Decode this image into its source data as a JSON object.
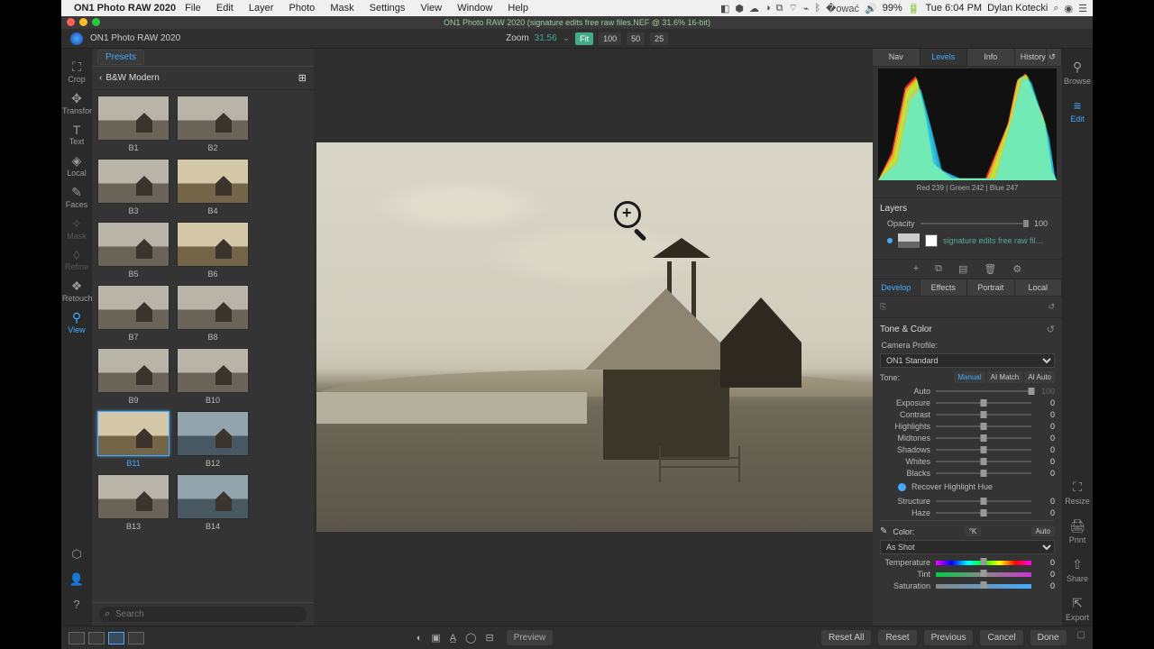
{
  "menubar": {
    "app": "ON1 Photo RAW 2020",
    "items": [
      "File",
      "Edit",
      "Layer",
      "Photo",
      "Mask",
      "Settings",
      "View",
      "Window",
      "Help"
    ],
    "battery": "99%",
    "clock": "Tue 6:04 PM",
    "user": "Dylan Kotecki"
  },
  "window": {
    "title": "ON1 Photo RAW 2020 (signature edits free raw files.NEF @ 31.6% 16-bit)"
  },
  "toolbar": {
    "app_label": "ON1 Photo RAW 2020",
    "zoom_label": "Zoom",
    "zoom_value": "31.56",
    "zoom_buttons": [
      "Fit",
      "100",
      "50",
      "25"
    ]
  },
  "tools": [
    {
      "label": "Crop",
      "active": false
    },
    {
      "label": "Transform",
      "active": false
    },
    {
      "label": "Text",
      "active": false
    },
    {
      "label": "Local",
      "active": false
    },
    {
      "label": "Faces",
      "active": false
    },
    {
      "label": "Mask",
      "dim": true
    },
    {
      "label": "Refine",
      "dim": true
    },
    {
      "label": "Retouch",
      "active": false
    },
    {
      "label": "View",
      "active": true
    }
  ],
  "presets": {
    "tab": "Presets",
    "category": "B&W Modern",
    "search_placeholder": "Search",
    "items": [
      {
        "label": "B1"
      },
      {
        "label": "B2"
      },
      {
        "label": "B3"
      },
      {
        "label": "B4",
        "warm": true
      },
      {
        "label": "B5"
      },
      {
        "label": "B6",
        "warm": true
      },
      {
        "label": "B7"
      },
      {
        "label": "B8"
      },
      {
        "label": "B9"
      },
      {
        "label": "B10"
      },
      {
        "label": "B11",
        "sel": true,
        "warm": true
      },
      {
        "label": "B12",
        "cool": true
      },
      {
        "label": "B13"
      },
      {
        "label": "B14",
        "cool": true
      }
    ]
  },
  "right_tabs": [
    "Nav",
    "Levels",
    "Info",
    "History"
  ],
  "right_active": "Levels",
  "histogram_label": "Red 239 | Green 242 | Blue 247",
  "layers": {
    "title": "Layers",
    "opacity_label": "Opacity",
    "opacity_value": "100",
    "layer_name": "signature edits free raw files.NEF"
  },
  "subtabs": [
    "Develop",
    "Effects",
    "Portrait",
    "Local"
  ],
  "subtab_active": "Develop",
  "tone_color": {
    "title": "Tone & Color",
    "camera_profile_label": "Camera Profile:",
    "camera_profile": "ON1 Standard",
    "tone_label": "Tone:",
    "tone_buttons": [
      "Manual",
      "AI Match",
      "AI Auto"
    ],
    "auto_label": "Auto",
    "auto_value": "100",
    "sliders": [
      {
        "label": "Exposure",
        "value": "0"
      },
      {
        "label": "Contrast",
        "value": "0"
      },
      {
        "label": "Highlights",
        "value": "0"
      },
      {
        "label": "Midtones",
        "value": "0"
      },
      {
        "label": "Shadows",
        "value": "0"
      },
      {
        "label": "Whites",
        "value": "0"
      },
      {
        "label": "Blacks",
        "value": "0"
      }
    ],
    "recover": "Recover Highlight Hue",
    "structure": {
      "label": "Structure",
      "value": "0"
    },
    "haze": {
      "label": "Haze",
      "value": "0"
    },
    "color_label": "Color:",
    "kb": "°K",
    "auto_btn": "Auto",
    "as_shot": "As Shot",
    "temperature": {
      "label": "Temperature",
      "value": "0"
    },
    "tint": {
      "label": "Tint",
      "value": "0"
    },
    "saturation": {
      "label": "Saturation",
      "value": "0"
    }
  },
  "rightstrip": [
    {
      "label": "Browse"
    },
    {
      "label": "Edit",
      "active": true
    },
    {
      "label": "Resize"
    },
    {
      "label": "Print"
    },
    {
      "label": "Share"
    },
    {
      "label": "Export"
    }
  ],
  "footer": {
    "preview": "Preview",
    "buttons": [
      "Reset All",
      "Reset",
      "Previous",
      "Cancel",
      "Done"
    ]
  }
}
